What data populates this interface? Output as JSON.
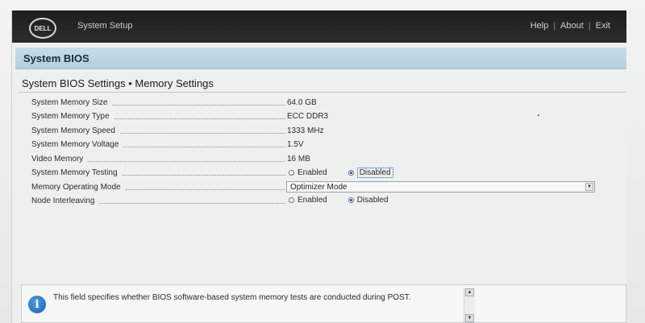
{
  "header": {
    "logo_text": "DELL",
    "app_title": "System Setup",
    "links": [
      "Help",
      "About",
      "Exit"
    ],
    "separator": "|"
  },
  "section_title": "System BIOS",
  "page_heading": "System BIOS Settings • Memory Settings",
  "settings": {
    "memory_size": {
      "label": "System Memory Size",
      "value": "64.0 GB"
    },
    "memory_type": {
      "label": "System Memory Type",
      "value": "ECC DDR3"
    },
    "memory_speed": {
      "label": "System Memory Speed",
      "value": "1333 MHz"
    },
    "memory_voltage": {
      "label": "System Memory Voltage",
      "value": "1.5V"
    },
    "video_memory": {
      "label": "Video Memory",
      "value": "16 MB"
    },
    "memory_testing": {
      "label": "System Memory Testing",
      "options": [
        "Enabled",
        "Disabled"
      ],
      "selected": "Disabled"
    },
    "operating_mode": {
      "label": "Memory Operating Mode",
      "value": "Optimizer Mode"
    },
    "node_interleaving": {
      "label": "Node Interleaving",
      "options": [
        "Enabled",
        "Disabled"
      ],
      "selected": "Disabled"
    }
  },
  "help": {
    "text": "This field specifies whether BIOS software-based system memory tests are conducted during POST."
  },
  "icons": {
    "info": "info-icon",
    "dropdown": "chevron-down-icon",
    "scroll_up": "arrow-up-icon",
    "scroll_down": "arrow-down-icon"
  }
}
